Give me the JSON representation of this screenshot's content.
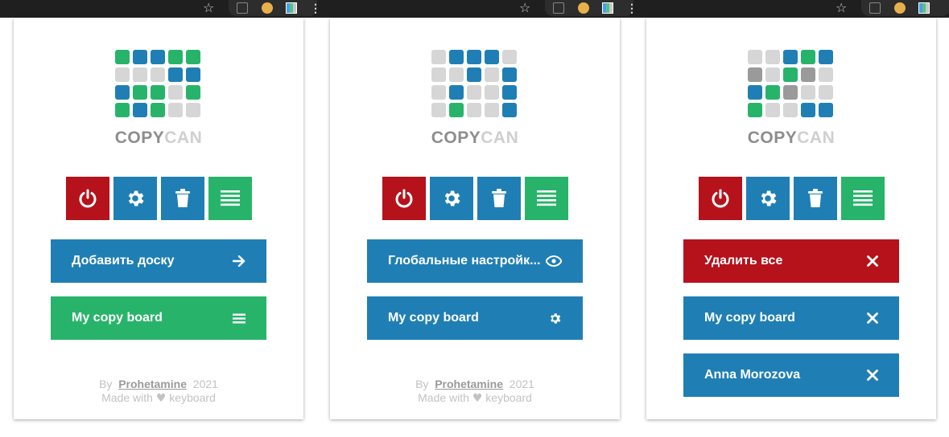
{
  "browser": {
    "star": "☆",
    "more": "⋮"
  },
  "brand": {
    "part1": "COPY",
    "part2": "CAN"
  },
  "colors": {
    "red": "#b5121b",
    "blue": "#1f7fb4",
    "green": "#27b46a",
    "light": "#d6d6d6",
    "dark": "#9a9a9a"
  },
  "toolbar": {
    "power": "power-icon",
    "settings": "gear-icon",
    "trash": "trash-icon",
    "list": "list-icon"
  },
  "panels": [
    {
      "logo": [
        "green",
        "blue",
        "blue",
        "green",
        "green",
        "light",
        "light",
        "light",
        "blue",
        "blue",
        "blue",
        "green",
        "green",
        "light",
        "green",
        "green",
        "blue",
        "green",
        "light",
        "light"
      ],
      "actions": [
        {
          "label": "Добавить доску",
          "icon": "arrow-right-icon"
        },
        {
          "label": "My copy board",
          "icon": "list-icon"
        }
      ],
      "credit": {
        "by": "By",
        "author": "Prohetamine",
        "year": "2021",
        "made": "Made with",
        "heart": "♥",
        "keyboard": "keyboard"
      }
    },
    {
      "logo": [
        "light",
        "blue",
        "blue",
        "blue",
        "light",
        "light",
        "light",
        "blue",
        "light",
        "blue",
        "light",
        "blue",
        "light",
        "light",
        "blue",
        "light",
        "green",
        "light",
        "light",
        "blue"
      ],
      "actions": [
        {
          "label": "Глобальные настройк...",
          "icon": "eye-icon"
        },
        {
          "label": "My copy board",
          "icon": "gear-icon"
        }
      ],
      "credit": {
        "by": "By",
        "author": "Prohetamine",
        "year": "2021",
        "made": "Made with",
        "heart": "♥",
        "keyboard": "keyboard"
      }
    },
    {
      "logo": [
        "light",
        "light",
        "blue",
        "green",
        "blue",
        "dark",
        "light",
        "green",
        "dark",
        "light",
        "blue",
        "green",
        "dark",
        "light",
        "light",
        "green",
        "light",
        "light",
        "blue",
        "blue"
      ],
      "actions": [
        {
          "label": "Удалить все",
          "icon": "close-icon"
        },
        {
          "label": "My copy board",
          "icon": "close-icon"
        },
        {
          "label": "Anna Morozova",
          "icon": "close-icon"
        }
      ]
    }
  ]
}
